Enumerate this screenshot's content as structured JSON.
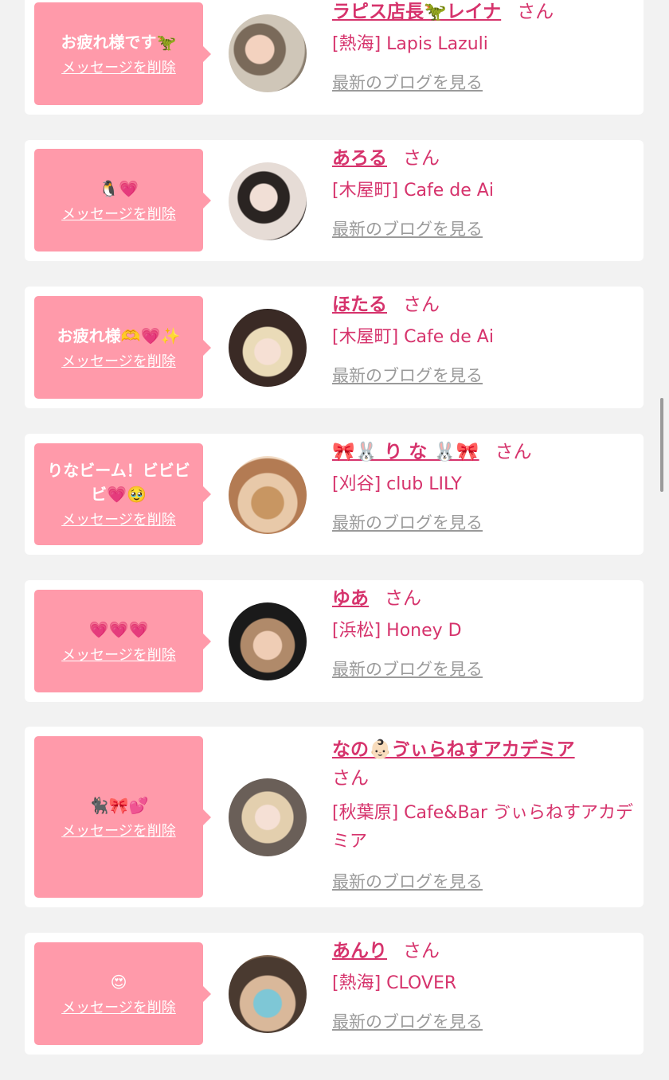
{
  "colors": {
    "accent": "#d6336c",
    "bubble": "#ff9aaa",
    "blog_link": "#9a9a9a",
    "background": "#f2f2f2"
  },
  "delete_label": "メッセージを削除",
  "blog_label": "最新のブログを見る",
  "san_label": "さん",
  "cards": [
    {
      "message": "お疲れ様です🦖",
      "name": "ラピス店長🦖レイナ",
      "shop": "[熱海] Lapis Lazuli"
    },
    {
      "message": "🐧💗",
      "name": "あろる",
      "shop": "[木屋町] Cafe de Ai"
    },
    {
      "message": "お疲れ様🫶💗✨",
      "name": "ほたる",
      "shop": "[木屋町] Cafe de Ai"
    },
    {
      "message": "りなビーム！ビビビビ💗🥹",
      "name": "🎀🐰 り な 🐰🎀",
      "shop": "[刈谷] club LILY"
    },
    {
      "message": "💗💗💗",
      "name": "ゆあ",
      "shop": "[浜松] Honey D"
    },
    {
      "message": "🐈‍⬛🎀💕",
      "name": "なの👶🏻ゔぃらねすアカデミア",
      "shop": "[秋葉原] Cafe&Bar ゔぃらねすアカデミア"
    },
    {
      "message": "😍",
      "name": "あんり",
      "shop": "[熱海] CLOVER"
    }
  ]
}
